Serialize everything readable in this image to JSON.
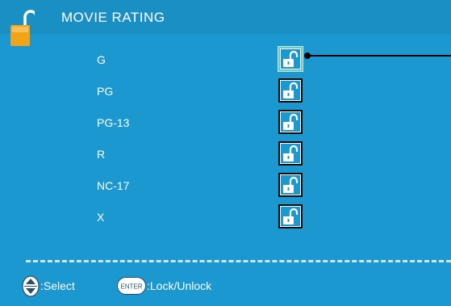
{
  "header": {
    "title": "MOVIE RATING",
    "icon": "unlocked-padlock-icon"
  },
  "ratings": [
    {
      "label": "G",
      "state": "unlocked",
      "selected": true
    },
    {
      "label": "PG",
      "state": "unlocked",
      "selected": false
    },
    {
      "label": "PG-13",
      "state": "unlocked",
      "selected": false
    },
    {
      "label": "R",
      "state": "unlocked",
      "selected": false
    },
    {
      "label": "NC-17",
      "state": "unlocked",
      "selected": false
    },
    {
      "label": "X",
      "state": "unlocked",
      "selected": false
    }
  ],
  "footer": {
    "select_label": ":Select",
    "enter_key_label": "ENTER",
    "lock_label": ":Lock/Unlock"
  },
  "colors": {
    "background": "#1b98cf",
    "header": "#1a8fc4",
    "text": "#ffffff",
    "selection": "#6ec8c0"
  }
}
